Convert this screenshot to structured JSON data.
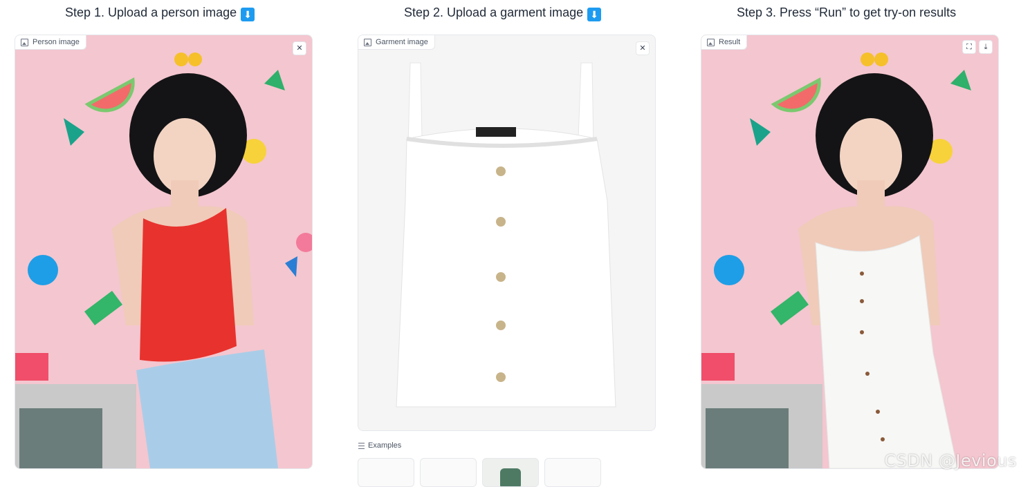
{
  "steps": {
    "step1": {
      "title": "Step 1. Upload a person image",
      "emoji": "⬇"
    },
    "step2": {
      "title": "Step 2. Upload a garment image",
      "emoji": "⬇"
    },
    "step3": {
      "title": "Step 3. Press “Run” to get try-on results"
    }
  },
  "panels": {
    "person": {
      "label": "Person image",
      "close": "✕"
    },
    "garment": {
      "label": "Garment image",
      "close": "✕"
    },
    "result": {
      "label": "Result",
      "fullscreen": "⛶",
      "download": "⤓"
    }
  },
  "examples": {
    "label": "Examples"
  },
  "watermark": "CSDN @Jevious",
  "colors": {
    "accent_blue": "#1d9bf0",
    "wall_pink": "#f4c6cf",
    "top_red": "#e8322e",
    "jeans_blue": "#a9cde8"
  }
}
